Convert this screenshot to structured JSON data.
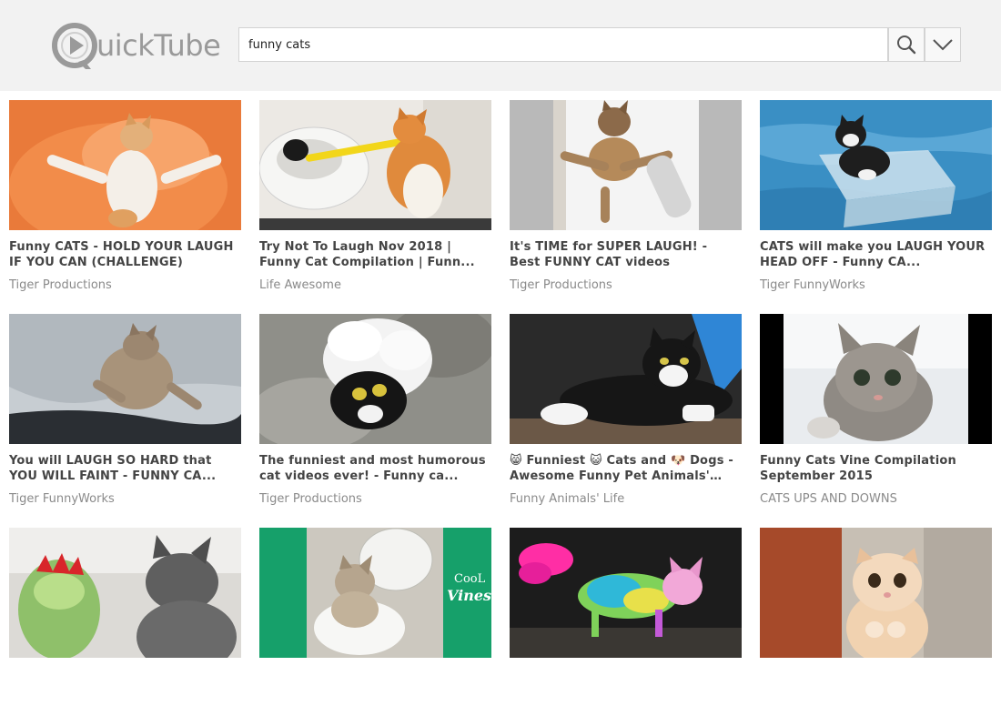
{
  "app": {
    "logo_text": "uickTube"
  },
  "search": {
    "query": "funny cats"
  },
  "icons": {
    "search": "magnifier-icon",
    "dropdown": "chevron-down-icon"
  },
  "videos": [
    {
      "title": "Funny CATS - HOLD YOUR LAUGH IF YOU CAN (CHALLENGE)",
      "channel": "Tiger Productions"
    },
    {
      "title": "Try Not To Laugh Nov 2018 | Funny Cat Compilation | Funn...",
      "channel": "Life Awesome"
    },
    {
      "title": "It's TIME for SUPER LAUGH! - Best FUNNY CAT videos",
      "channel": "Tiger Productions"
    },
    {
      "title": "CATS will make you LAUGH YOUR HEAD OFF - Funny CA...",
      "channel": "Tiger FunnyWorks"
    },
    {
      "title": "You will LAUGH SO HARD that YOU WILL FAINT - FUNNY CA...",
      "channel": "Tiger FunnyWorks"
    },
    {
      "title": "The funniest and most humorous cat videos ever! - Funny ca...",
      "channel": "Tiger Productions"
    },
    {
      "title": "😸 Funniest 😺 Cats and 🐶 Dogs - Awesome Funny Pet Animals' Lif...",
      "channel": "Funny Animals' Life"
    },
    {
      "title": "Funny Cats Vine Compilation September 2015",
      "channel": "CATS UPS AND DOWNS"
    },
    {
      "title": "",
      "channel": ""
    },
    {
      "title": "",
      "channel": "",
      "thumb_text_1": "CooL",
      "thumb_text_2": "Vines"
    },
    {
      "title": "",
      "channel": ""
    },
    {
      "title": "",
      "channel": ""
    }
  ]
}
